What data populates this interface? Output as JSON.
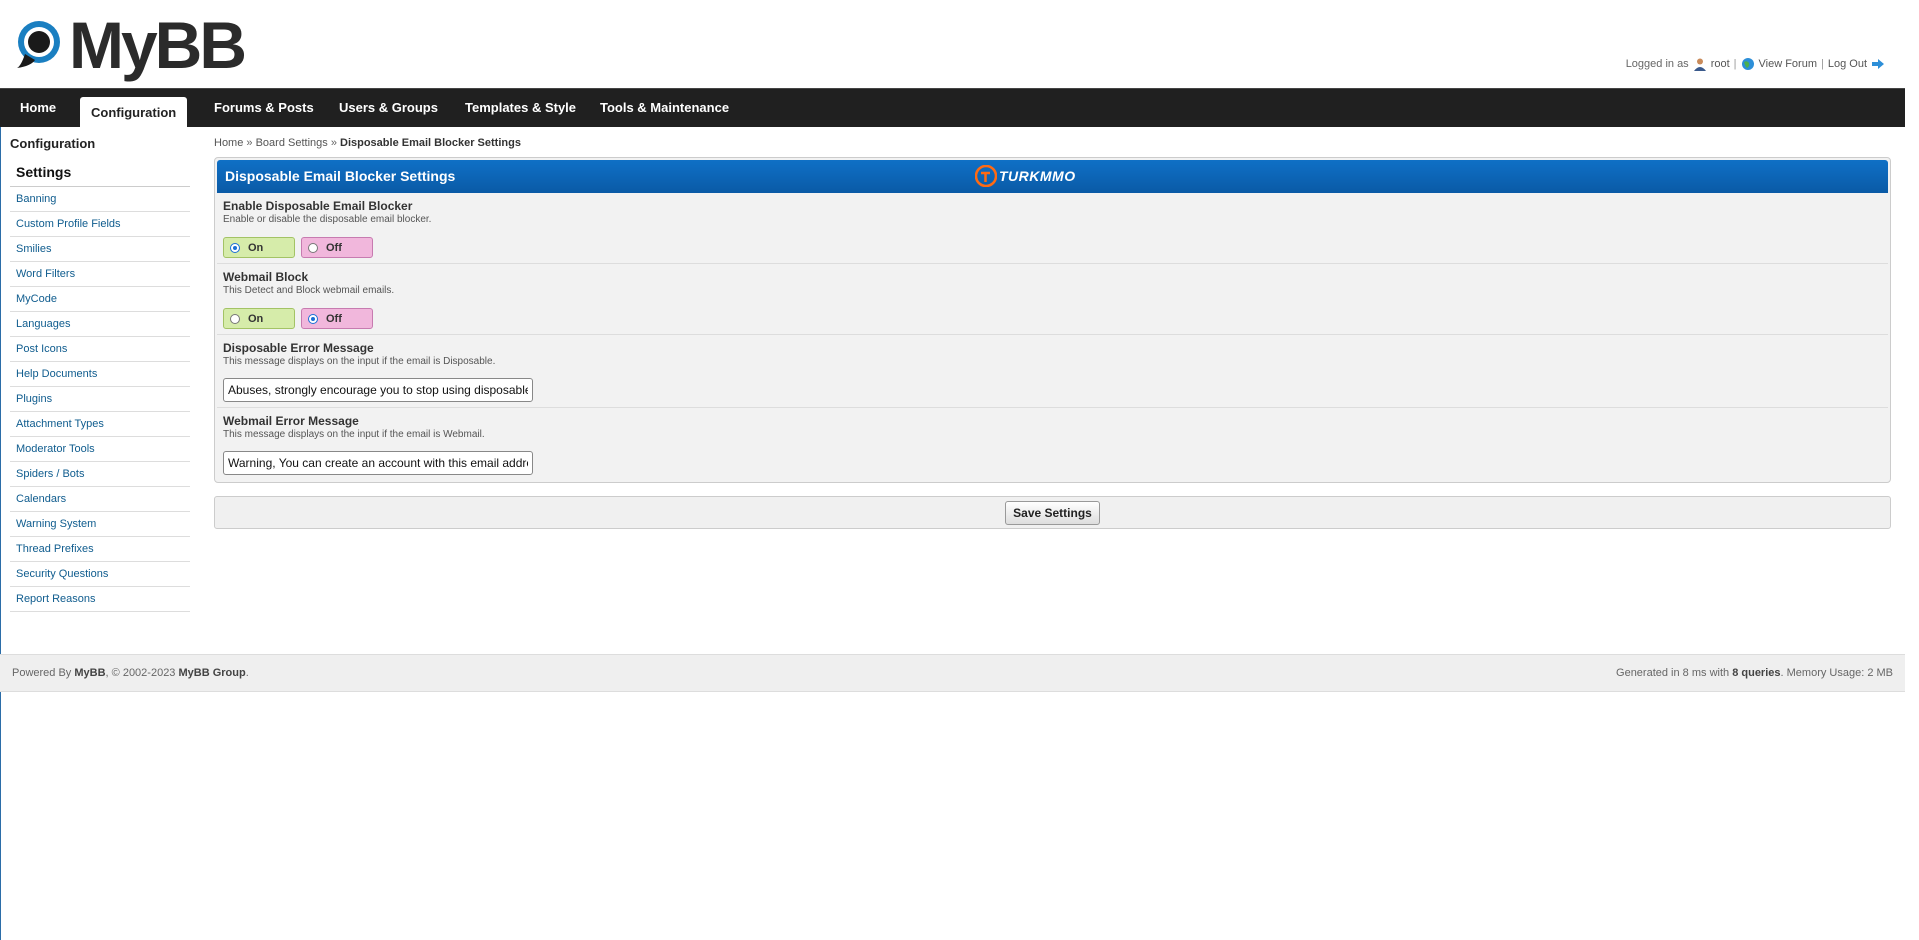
{
  "header": {
    "logo_text": "MyBB",
    "logged_in_label": "Logged in as",
    "username": "root",
    "view_forum": "View Forum",
    "log_out": "Log Out",
    "sep": "|"
  },
  "nav": {
    "items": [
      "Home",
      "Configuration",
      "Forums & Posts",
      "Users & Groups",
      "Templates & Style",
      "Tools & Maintenance"
    ],
    "active": "Configuration"
  },
  "sidebar": {
    "title": "Configuration",
    "heading": "Settings",
    "items": [
      "Banning",
      "Custom Profile Fields",
      "Smilies",
      "Word Filters",
      "MyCode",
      "Languages",
      "Post Icons",
      "Help Documents",
      "Plugins",
      "Attachment Types",
      "Moderator Tools",
      "Spiders / Bots",
      "Calendars",
      "Warning System",
      "Thread Prefixes",
      "Security Questions",
      "Report Reasons"
    ]
  },
  "breadcrumb": {
    "home": "Home",
    "board_settings": "Board Settings",
    "current": "Disposable Email Blocker Settings",
    "sep": "»"
  },
  "panel": {
    "title": "Disposable Email Blocker Settings",
    "brand_text": "TURKMMO",
    "brand_color": "#ff6a13",
    "settings": [
      {
        "title": "Enable Disposable Email Blocker",
        "desc": "Enable or disable the disposable email blocker.",
        "on_label": "On",
        "off_label": "Off",
        "selected": "On"
      },
      {
        "title": "Webmail Block",
        "desc": "This Detect and Block webmail emails.",
        "on_label": "On",
        "off_label": "Off",
        "selected": "Off"
      },
      {
        "title": "Disposable Error Message",
        "desc": "This message displays on the input if the email is Disposable.",
        "value": "Abuses, strongly encourage you to stop using disposable"
      },
      {
        "title": "Webmail Error Message",
        "desc": "This message displays on the input if the email is Webmail.",
        "value": "Warning, You can create an account with this email address"
      }
    ]
  },
  "save_button": "Save Settings",
  "footer": {
    "powered_prefix": "Powered By",
    "mybb": "MyBB",
    "copyright": ", © 2002-2023",
    "group": "MyBB Group",
    "period": ".",
    "generated_prefix": "Generated in 8 ms with",
    "queries": "8 queries",
    "memory": ". Memory Usage: 2 MB"
  },
  "colors": {
    "nav_bg": "#202020",
    "panel_header": "#0a5aa6",
    "link": "#0f5c8e",
    "radio_on_bg": "#d6ecaa",
    "radio_off_bg": "#f1b7dc"
  }
}
